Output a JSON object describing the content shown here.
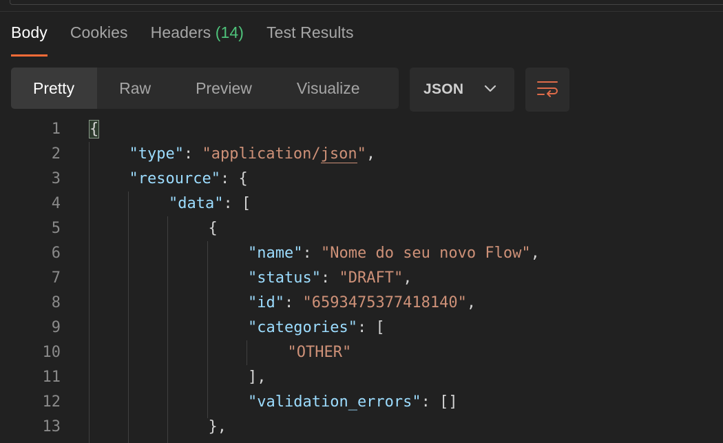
{
  "tabs": [
    {
      "label": "Body",
      "active": true
    },
    {
      "label": "Cookies"
    },
    {
      "label": "Headers",
      "count": "(14)"
    },
    {
      "label": "Test Results"
    }
  ],
  "view_modes": [
    "Pretty",
    "Raw",
    "Preview",
    "Visualize"
  ],
  "active_view": "Pretty",
  "format": {
    "label": "JSON",
    "icon": "chevron-down-icon"
  },
  "wrap_button": {
    "icon": "word-wrap-icon"
  },
  "colors": {
    "accent": "#ff6c37",
    "count": "#4ec27a",
    "json_key": "#9cdcfe",
    "json_string": "#ce9178"
  },
  "code_lines": [
    {
      "n": "1",
      "indent": 0,
      "tokens": [
        [
          "brace",
          "{"
        ]
      ]
    },
    {
      "n": "2",
      "indent": 1,
      "tokens": [
        [
          "key",
          "\"type\""
        ],
        [
          "punc",
          ": "
        ],
        [
          "str",
          "\"application/"
        ],
        [
          "stru",
          "json"
        ],
        [
          "str",
          "\""
        ],
        [
          "punc",
          ","
        ]
      ]
    },
    {
      "n": "3",
      "indent": 1,
      "tokens": [
        [
          "key",
          "\"resource\""
        ],
        [
          "punc",
          ": {"
        ]
      ]
    },
    {
      "n": "4",
      "indent": 2,
      "tokens": [
        [
          "key",
          "\"data\""
        ],
        [
          "punc",
          ": ["
        ]
      ]
    },
    {
      "n": "5",
      "indent": 3,
      "tokens": [
        [
          "punc",
          "{"
        ]
      ]
    },
    {
      "n": "6",
      "indent": 4,
      "tokens": [
        [
          "key",
          "\"name\""
        ],
        [
          "punc",
          ": "
        ],
        [
          "str",
          "\"Nome do seu novo Flow\""
        ],
        [
          "punc",
          ","
        ]
      ]
    },
    {
      "n": "7",
      "indent": 4,
      "tokens": [
        [
          "key",
          "\"status\""
        ],
        [
          "punc",
          ": "
        ],
        [
          "str",
          "\"DRAFT\""
        ],
        [
          "punc",
          ","
        ]
      ]
    },
    {
      "n": "8",
      "indent": 4,
      "tokens": [
        [
          "key",
          "\"id\""
        ],
        [
          "punc",
          ": "
        ],
        [
          "str",
          "\"6593475377418140\""
        ],
        [
          "punc",
          ","
        ]
      ]
    },
    {
      "n": "9",
      "indent": 4,
      "tokens": [
        [
          "key",
          "\"categories\""
        ],
        [
          "punc",
          ": ["
        ]
      ]
    },
    {
      "n": "10",
      "indent": 5,
      "tokens": [
        [
          "str",
          "\"OTHER\""
        ]
      ]
    },
    {
      "n": "11",
      "indent": 4,
      "tokens": [
        [
          "punc",
          "],"
        ]
      ]
    },
    {
      "n": "12",
      "indent": 4,
      "tokens": [
        [
          "key",
          "\"validation_errors\""
        ],
        [
          "punc",
          ": []"
        ]
      ]
    },
    {
      "n": "13",
      "indent": 3,
      "tokens": [
        [
          "punc",
          "},"
        ]
      ]
    }
  ]
}
